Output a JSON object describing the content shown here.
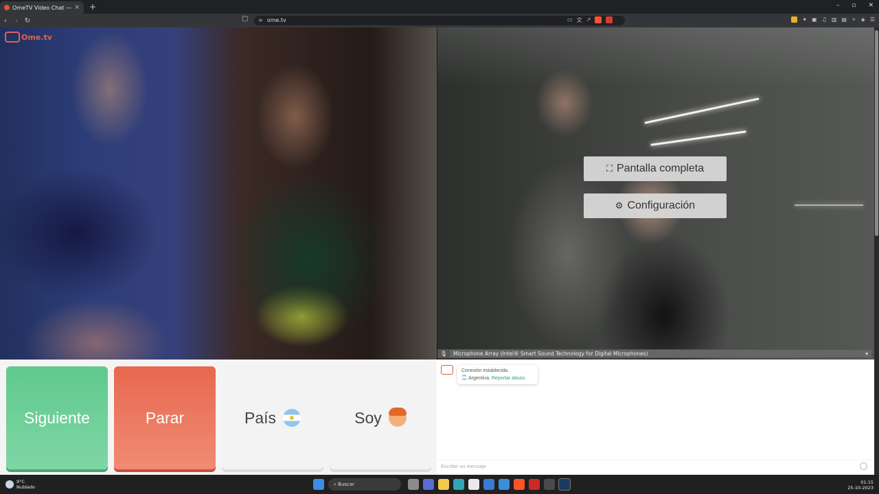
{
  "browser": {
    "tab_title": "OmeTV Video Chat — Ome...",
    "tab_close": "×",
    "new_tab": "+",
    "url": "ome.tv",
    "window_controls": [
      "–",
      "▫",
      "✕"
    ]
  },
  "site": {
    "logo_text": "Ome.tv"
  },
  "video_menu": {
    "fullscreen_label": "Pantalla completa",
    "settings_label": "Configuración"
  },
  "microphone": {
    "selected": "Microphone Array (Intel® Smart Sound Technology for Digital Microphones)"
  },
  "controls": {
    "next_label": "Siguiente",
    "stop_label": "Parar",
    "country_label": "País",
    "country_flag": "Argentina",
    "gender_label": "Soy"
  },
  "chat": {
    "status_line": "Conexión establecida.",
    "country_text": "Argentina.",
    "report_link": "Reportar abuso.",
    "input_placeholder": "Escribe un mensaje"
  },
  "taskbar": {
    "weather_temp": "9°C",
    "weather_desc": "Nublado",
    "search_label": "Buscar",
    "time": "01:15",
    "date": "25-10-2023"
  },
  "colors": {
    "next": "#5fc98d",
    "stop": "#e8684e",
    "accent": "#e0533d"
  }
}
